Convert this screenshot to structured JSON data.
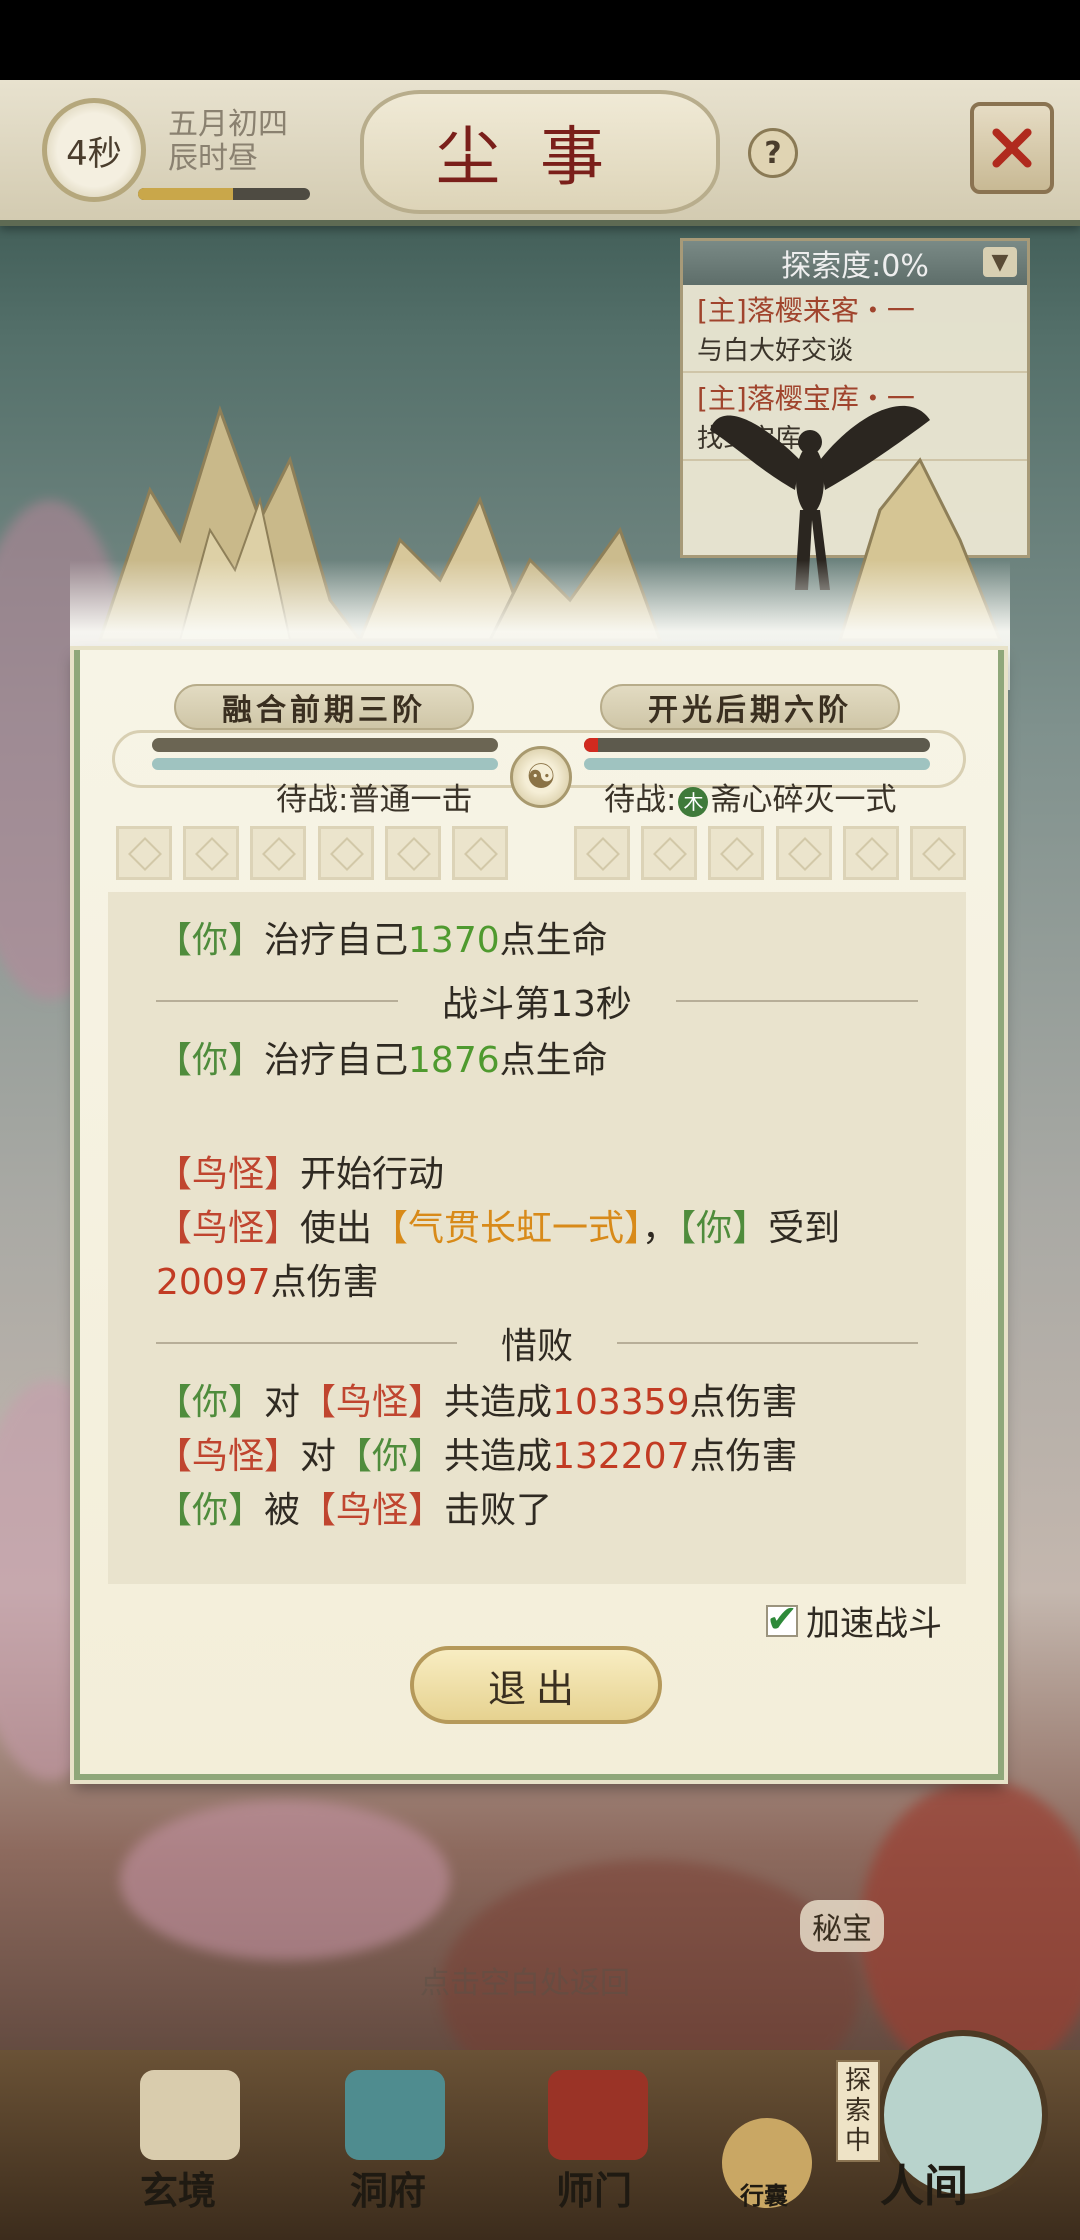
{
  "header": {
    "timer": "4秒",
    "date_line1": "五月初四",
    "date_line2": "辰时昼",
    "time_progress": 0.55,
    "title": "尘事",
    "help_symbol": "?"
  },
  "quest_panel": {
    "title": "探索度:0%",
    "toggle_icon": "chevron-down-icon",
    "items": [
      {
        "title": "[主]落樱来客・一",
        "desc": "与白大好交谈"
      },
      {
        "title": "[主]落樱宝库・一",
        "desc": "找到宝库"
      }
    ]
  },
  "battle": {
    "left_realm": "融合前期三阶",
    "right_realm": "开光后期六阶",
    "left_hp": 1.0,
    "left_mp": 1.0,
    "right_hp": 0.04,
    "right_mp": 1.0,
    "left_ready": "待战:普通一击",
    "right_ready_prefix": "待战:",
    "right_ready_badge": "木",
    "right_ready_skill": "斋心碎灭一式",
    "colors": {
      "hp_left": "#6b6553",
      "hp_right": "#d12a1f",
      "mp": "#9fc3c0"
    }
  },
  "log": {
    "you": "【你】",
    "monster": "【鸟怪】",
    "l1_text": "治疗自己",
    "l1_num": "1370",
    "l1_suffix": "点生命",
    "divider1": "战斗第13秒",
    "l2_text": "治疗自己",
    "l2_num": "1876",
    "l2_suffix": "点生命",
    "l3_text": "开始行动",
    "l4_use": "使出",
    "l4_skill": "【气贯长虹一式】",
    "l4_comma": "，",
    "l4_recv": "受到",
    "l5_num": "20097",
    "l5_suffix": "点伤害",
    "divider2": "惜败",
    "l6_to": "对",
    "l6_total": "共造成",
    "l6_num": "103359",
    "l6_suffix": "点伤害",
    "l7_to": "对",
    "l7_total": "共造成",
    "l7_num": "132207",
    "l7_suffix": "点伤害",
    "l8_by": "被",
    "l8_end": "击败了"
  },
  "controls": {
    "speed_label": "加速战斗",
    "speed_checked": true,
    "exit_label": "退出"
  },
  "scene": {
    "treasure_tag": "秘宝",
    "explore_tag": "探索中",
    "hint": "点击空白处返回"
  },
  "nav": {
    "items": [
      "玄境",
      "洞府",
      "师门",
      "行囊",
      "人间"
    ]
  }
}
